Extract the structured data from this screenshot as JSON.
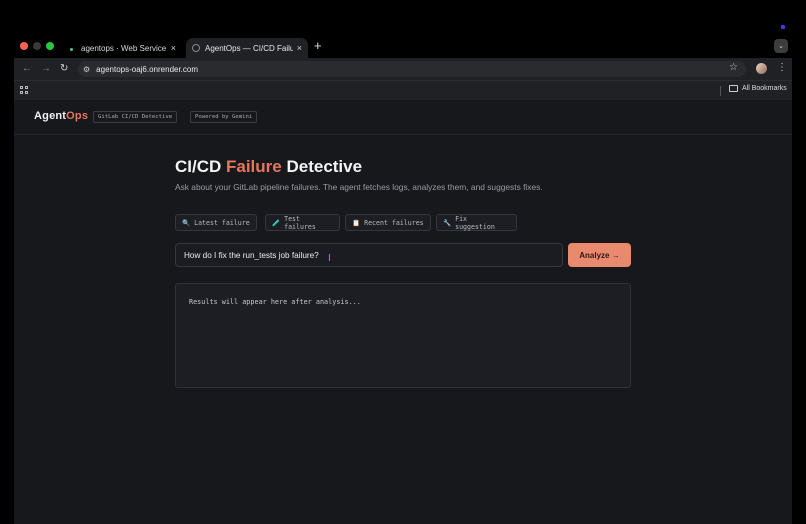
{
  "browser": {
    "tabs": [
      {
        "title": "agentops · Web Service · R",
        "active": false
      },
      {
        "title": "AgentOps — CI/CD Failure De",
        "active": true
      }
    ],
    "url": "agentops-oaj6.onrender.com",
    "bookmarks_label": "All Bookmarks",
    "new_tab_symbol": "+",
    "close_symbol": "×"
  },
  "app": {
    "logo_main": "Agent",
    "logo_accent": "Ops",
    "pills": [
      "GitLab CI/CD Detective",
      "Powered by Gemini"
    ],
    "title_part1": "CI/CD ",
    "title_accent": "Failure",
    "title_part2": " Detective",
    "subtitle": "Ask about your GitLab pipeline failures. The agent fetches logs, analyzes them, and suggests fixes.",
    "chips": [
      {
        "icon": "🔍",
        "icon_name": "magnifier-icon",
        "label": "Latest failure"
      },
      {
        "icon": "🧪",
        "icon_name": "test-tube-icon",
        "label": "Test failures"
      },
      {
        "icon": "📋",
        "icon_name": "clipboard-icon",
        "label": "Recent failures"
      },
      {
        "icon": "🔧",
        "icon_name": "wrench-icon",
        "label": "Fix suggestion"
      }
    ],
    "query_value": "How do I fix the run_tests job failure?",
    "analyze_label": "Analyze →",
    "results_placeholder": "Results will appear here after analysis..."
  },
  "colors": {
    "accent": "#e8765a",
    "button": "#e98a6e",
    "page_bg": "#16181c"
  }
}
